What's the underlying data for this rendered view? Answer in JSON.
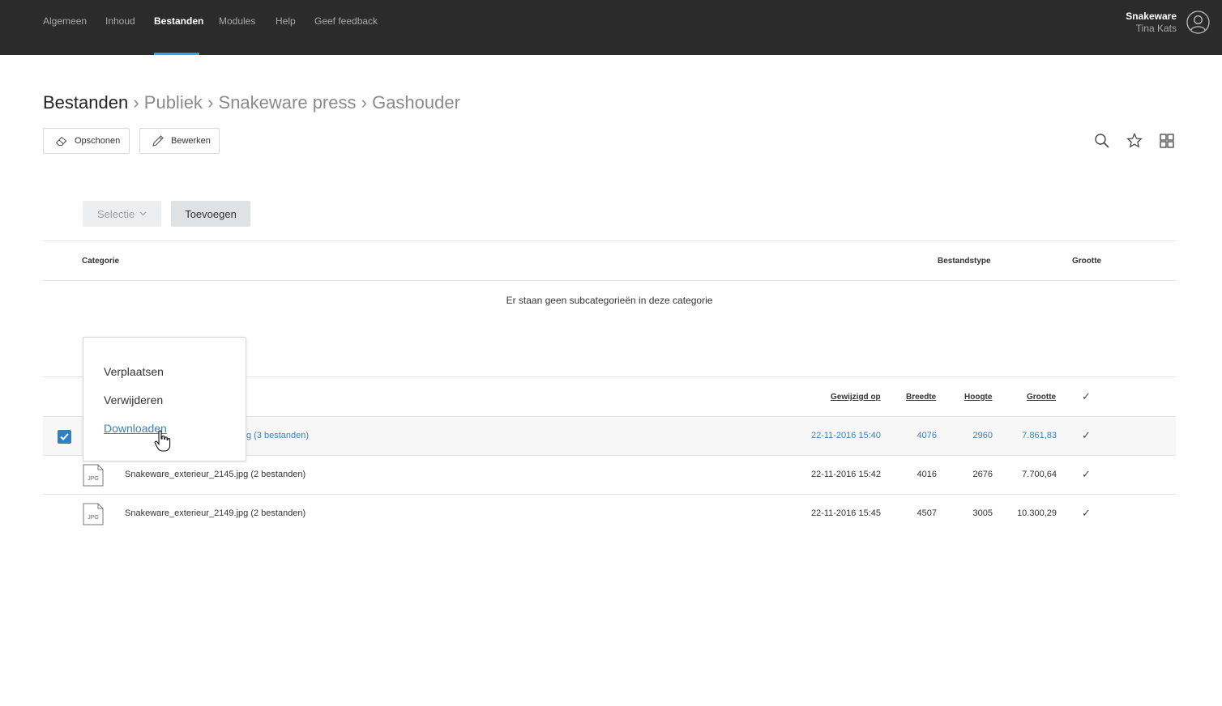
{
  "nav": {
    "items": [
      "Algemeen",
      "Inhoud",
      "Bestanden",
      "Modules",
      "Help",
      "Geef feedback"
    ],
    "active": "Bestanden"
  },
  "user": {
    "org": "Snakeware",
    "name": "Tina Kats",
    "icon": "user-avatar-icon"
  },
  "breadcrumb": {
    "root": "Bestanden",
    "separator": "›",
    "parts": [
      "Publiek",
      "Snakeware press",
      "Gashouder"
    ]
  },
  "toolbar": {
    "clean_label": "Opschonen",
    "clean_icon": "eraser-icon",
    "edit_label": "Bewerken",
    "edit_icon": "pencil-icon",
    "right_icons": [
      "search-icon",
      "star-icon",
      "grid-icon"
    ]
  },
  "actions": {
    "select_label": "Selectie",
    "add_label": "Toevoegen"
  },
  "categories": {
    "headers": {
      "category": "Categorie",
      "filetype": "Bestandstype",
      "size": "Grootte"
    },
    "empty_message": "Er staan geen subcategorieën in deze categorie"
  },
  "files": {
    "headers": {
      "modified": "Gewijzigd op",
      "width": "Breedte",
      "height": "Hoogte",
      "size": "Grootte",
      "check": "✓"
    },
    "rows": [
      {
        "name": "g (3 bestanden)",
        "modified": "22-11-2016 15:40",
        "width": "4076",
        "height": "2960",
        "size": "7.861,83",
        "check": "✓",
        "selected": true
      },
      {
        "name": "Snakeware_exterieur_2145.jpg (2 bestanden)",
        "modified": "22-11-2016 15:42",
        "width": "4016",
        "height": "2676",
        "size": "7.700,64",
        "check": "✓",
        "selected": false
      },
      {
        "name": "Snakeware_exterieur_2149.jpg (2 bestanden)",
        "modified": "22-11-2016 15:45",
        "width": "4507",
        "height": "3005",
        "size": "10.300,29",
        "check": "✓",
        "selected": false
      }
    ],
    "file_icon_label": "JPG"
  },
  "dropdown": {
    "items": [
      "Verplaatsen",
      "Verwijderen",
      "Downloaden"
    ]
  },
  "colors": {
    "topbar": "#2b2b2b",
    "accent": "#3aa0e6",
    "link": "#3a7fc2",
    "checkbox": "#2f7ec8"
  }
}
